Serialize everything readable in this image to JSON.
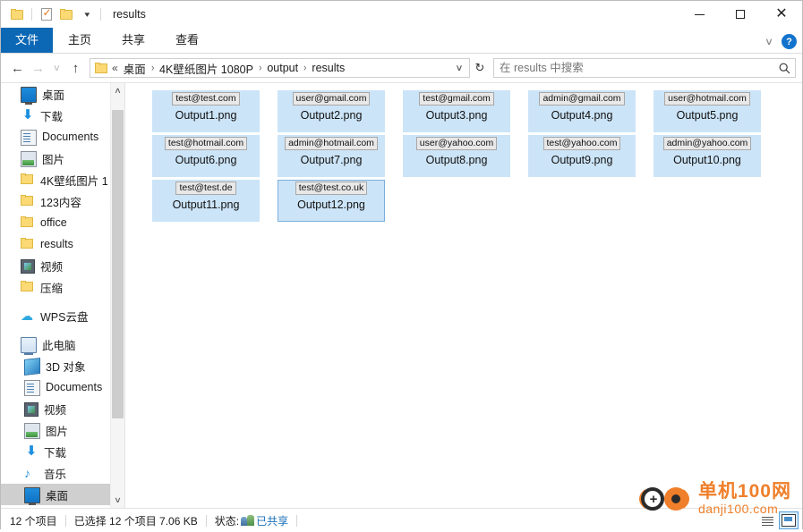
{
  "window": {
    "title": "results",
    "quick_access": [
      {
        "name": "folder-icon",
        "tooltip": "属性"
      },
      {
        "name": "properties-icon",
        "tooltip": "属性"
      },
      {
        "name": "new-folder-icon",
        "tooltip": "新建文件夹"
      }
    ],
    "controls": {
      "minimize": "—",
      "maximize": "□",
      "close": "✕"
    }
  },
  "ribbon": {
    "tabs": [
      {
        "label": "文件",
        "active": true
      },
      {
        "label": "主页",
        "active": false
      },
      {
        "label": "共享",
        "active": false
      },
      {
        "label": "查看",
        "active": false
      }
    ],
    "expand_label": "∨",
    "help_label": "?"
  },
  "addressbar": {
    "back": "←",
    "forward": "→",
    "recent": "∨",
    "up": "↑",
    "lead": "«",
    "crumbs": [
      "桌面",
      "4K壁纸图片 1080P",
      "output",
      "results"
    ],
    "separator": "›",
    "dropdown": "∨",
    "refresh": "↻"
  },
  "search": {
    "placeholder": "在 results 中搜索",
    "value": "",
    "icon": "⌕"
  },
  "sidebar": {
    "items": [
      {
        "label": "桌面",
        "icon": "desktop-icon",
        "pinned": true,
        "indent": 0,
        "selected": false
      },
      {
        "label": "下载",
        "icon": "download-icon",
        "pinned": true,
        "indent": 0,
        "selected": false
      },
      {
        "label": "Documents",
        "icon": "documents-icon",
        "pinned": true,
        "indent": 0,
        "selected": false
      },
      {
        "label": "图片",
        "icon": "pictures-icon",
        "pinned": true,
        "indent": 0,
        "selected": false
      },
      {
        "label": "4K壁纸图片 1",
        "icon": "folder-icon",
        "pinned": true,
        "indent": 0,
        "selected": false
      },
      {
        "label": "123内容",
        "icon": "folder-icon",
        "pinned": true,
        "indent": 0,
        "selected": false
      },
      {
        "label": "office",
        "icon": "folder-icon",
        "pinned": false,
        "indent": 0,
        "selected": false
      },
      {
        "label": "results",
        "icon": "folder-icon",
        "pinned": false,
        "indent": 0,
        "selected": false
      },
      {
        "label": "视频",
        "icon": "video-icon",
        "pinned": false,
        "indent": 0,
        "selected": false
      },
      {
        "label": "压缩",
        "icon": "folder-icon",
        "pinned": false,
        "indent": 0,
        "selected": false
      },
      {
        "label": "WPS云盘",
        "icon": "cloud-icon",
        "pinned": false,
        "indent": 0,
        "selected": false,
        "gap_before": true
      },
      {
        "label": "此电脑",
        "icon": "this-pc-icon",
        "pinned": false,
        "indent": 0,
        "selected": false,
        "gap_before": true
      },
      {
        "label": "3D 对象",
        "icon": "3d-objects-icon",
        "pinned": false,
        "indent": 1,
        "selected": false
      },
      {
        "label": "Documents",
        "icon": "documents-icon",
        "pinned": false,
        "indent": 1,
        "selected": false
      },
      {
        "label": "视频",
        "icon": "video-icon",
        "pinned": false,
        "indent": 1,
        "selected": false
      },
      {
        "label": "图片",
        "icon": "pictures-icon",
        "pinned": false,
        "indent": 1,
        "selected": false
      },
      {
        "label": "下载",
        "icon": "download-icon",
        "pinned": false,
        "indent": 1,
        "selected": false
      },
      {
        "label": "音乐",
        "icon": "music-icon",
        "pinned": false,
        "indent": 1,
        "selected": false
      },
      {
        "label": "桌面",
        "icon": "desktop-icon",
        "pinned": false,
        "indent": 1,
        "selected": true
      }
    ],
    "scroll_up": "∧",
    "scroll_down": "∨"
  },
  "files": [
    {
      "thumb_text": "test@test.com",
      "name": "Output1.png",
      "selected": true,
      "focused": false
    },
    {
      "thumb_text": "user@gmail.com",
      "name": "Output2.png",
      "selected": true,
      "focused": false
    },
    {
      "thumb_text": "test@gmail.com",
      "name": "Output3.png",
      "selected": true,
      "focused": false
    },
    {
      "thumb_text": "admin@gmail.com",
      "name": "Output4.png",
      "selected": true,
      "focused": false
    },
    {
      "thumb_text": "user@hotmail.com",
      "name": "Output5.png",
      "selected": true,
      "focused": false
    },
    {
      "thumb_text": "test@hotmail.com",
      "name": "Output6.png",
      "selected": true,
      "focused": false
    },
    {
      "thumb_text": "admin@hotmail.com",
      "name": "Output7.png",
      "selected": true,
      "focused": false
    },
    {
      "thumb_text": "user@yahoo.com",
      "name": "Output8.png",
      "selected": true,
      "focused": false
    },
    {
      "thumb_text": "test@yahoo.com",
      "name": "Output9.png",
      "selected": true,
      "focused": false
    },
    {
      "thumb_text": "admin@yahoo.com",
      "name": "Output10.png",
      "selected": true,
      "focused": false
    },
    {
      "thumb_text": "test@test.de",
      "name": "Output11.png",
      "selected": true,
      "focused": false
    },
    {
      "thumb_text": "test@test.co.uk",
      "name": "Output12.png",
      "selected": true,
      "focused": true
    }
  ],
  "status": {
    "item_count": "12 个项目",
    "selection": "已选择 12 个项目  7.06 KB",
    "state_label": "状态:",
    "shared_label": "已共享",
    "view_large_icons": "large-icons-view",
    "view_details": "details-view"
  },
  "watermark": {
    "title": "单机100网",
    "url": "danji100.com"
  },
  "colors": {
    "accent": "#0c68b5",
    "selection": "#cce4f7",
    "focus_border": "#7aafdd",
    "watermark": "#ef7f2a",
    "shared_text": "#1a6fb8"
  }
}
